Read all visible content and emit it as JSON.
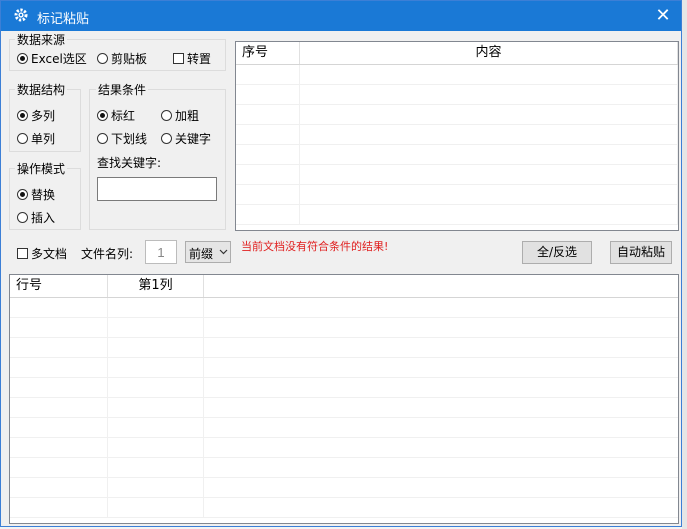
{
  "window": {
    "title": "标记粘贴",
    "close_glyph": "✕"
  },
  "source": {
    "group_label": "数据来源",
    "options": [
      {
        "label": "Excel选区",
        "selected": true
      },
      {
        "label": "剪贴板",
        "selected": false
      }
    ],
    "transpose": {
      "label": "转置",
      "checked": false
    }
  },
  "structure": {
    "group_label": "数据结构",
    "options": [
      {
        "label": "多列",
        "selected": true
      },
      {
        "label": "单列",
        "selected": false
      }
    ]
  },
  "result": {
    "group_label": "结果条件",
    "options": [
      {
        "label": "标红",
        "selected": true
      },
      {
        "label": "加粗",
        "selected": false
      },
      {
        "label": "下划线",
        "selected": false
      },
      {
        "label": "关键字",
        "selected": false
      }
    ],
    "keyword_label": "查找关键字:",
    "keyword_value": ""
  },
  "mode": {
    "group_label": "操作模式",
    "options": [
      {
        "label": "替换",
        "selected": true
      },
      {
        "label": "插入",
        "selected": false
      }
    ]
  },
  "top_table": {
    "columns": [
      "序号",
      "内容"
    ]
  },
  "toolbar": {
    "multi_doc_label": "多文档",
    "multi_doc_checked": false,
    "filename_col_label": "文件名列:",
    "filename_col_value": "1",
    "prefix_select_value": "前缀",
    "status_message": "当前文档没有符合条件的结果!",
    "select_all_label": "全/反选",
    "auto_paste_label": "自动粘贴"
  },
  "bottom_table": {
    "columns": [
      "行号",
      "第1列",
      ""
    ]
  },
  "colors": {
    "titlebar": "#1a79d6",
    "status_red": "#e02020"
  }
}
